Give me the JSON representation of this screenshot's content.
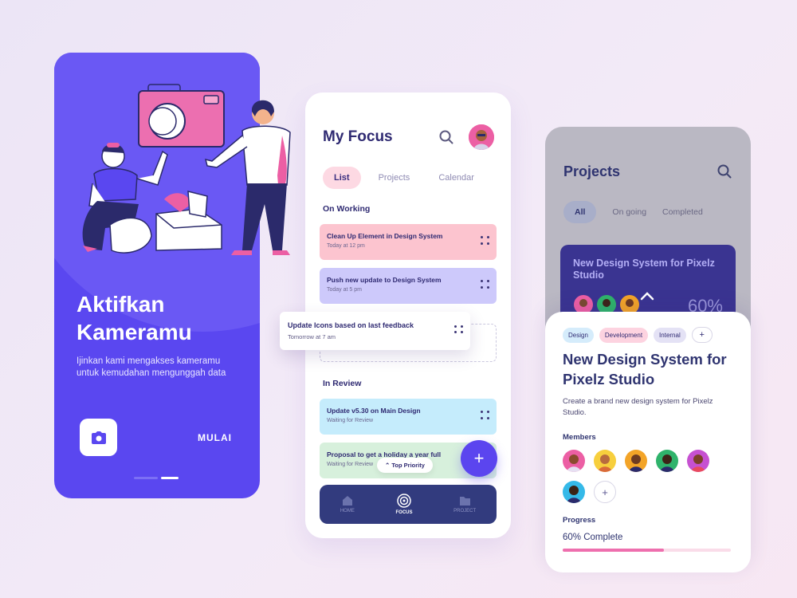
{
  "onboarding": {
    "title": "Aktifkan Kameramu",
    "description": "Ijinkan kami mengakses kameramu untuk kemudahan mengunggah data",
    "start_label": "MULAI",
    "colors": {
      "background": "#5a47f0",
      "accent": "#ec5fa4"
    }
  },
  "focus": {
    "title": "My Focus",
    "tabs": [
      {
        "label": "List",
        "active": true
      },
      {
        "label": "Projects",
        "active": false
      },
      {
        "label": "Calendar",
        "active": false
      }
    ],
    "sections": {
      "working": "On Working",
      "review": "In Review"
    },
    "working_tasks": [
      {
        "title": "Clean Up Element in Design System",
        "time": "Today at 12 pm",
        "color": "#fcc4cf"
      },
      {
        "title": "Push new update to Design System",
        "time": "Today at 5 pm",
        "color": "#cdc9fb"
      }
    ],
    "dragging_task": {
      "title": "Update Icons based on last feedback",
      "time": "Tomorrow at 7 am"
    },
    "review_tasks": [
      {
        "title": "Update v5.30 on Main Design",
        "time": "Waiting for Review",
        "color": "#c5ecfc"
      },
      {
        "title": "Proposal to get a holiday a year full",
        "time": "Waiting for Review",
        "color": "#d7f0dc"
      }
    ],
    "priority_chip": "Top Priority",
    "nav": [
      {
        "label": "HOME",
        "icon": "home-icon"
      },
      {
        "label": "FOCUS",
        "icon": "focus-icon",
        "active": true
      },
      {
        "label": "PROJECT",
        "icon": "folder-icon"
      }
    ]
  },
  "projects": {
    "title": "Projects",
    "tabs": [
      {
        "label": "All",
        "active": true
      },
      {
        "label": "On going"
      },
      {
        "label": "Completed"
      }
    ],
    "card": {
      "title": "New Design System for Pixelz Studio",
      "percent": "60%"
    }
  },
  "detail": {
    "tags": [
      {
        "label": "Design",
        "color": "#d5ecfb"
      },
      {
        "label": "Development",
        "color": "#fdd3e0"
      },
      {
        "label": "Internal",
        "color": "#e4e2f5"
      }
    ],
    "add_tag": "+",
    "title": "New Design System for Pixelz Studio",
    "description": "Create a brand new design system for Pixelz Studio.",
    "members_label": "Members",
    "members": [
      {
        "bg": "#ec5fa4",
        "skin": "#8a4b2e"
      },
      {
        "bg": "#f7cf3d",
        "skin": "#b86b3e"
      },
      {
        "bg": "#f3a428",
        "skin": "#6e3b22"
      },
      {
        "bg": "#2fb36b",
        "skin": "#3d2418"
      },
      {
        "bg": "#c651d1",
        "skin": "#7c4127"
      },
      {
        "bg": "#35b9e8",
        "skin": "#3a2216"
      }
    ],
    "add_member": "+",
    "progress_label": "Progress",
    "progress_text": "60% Complete",
    "progress_value": 0.6
  }
}
